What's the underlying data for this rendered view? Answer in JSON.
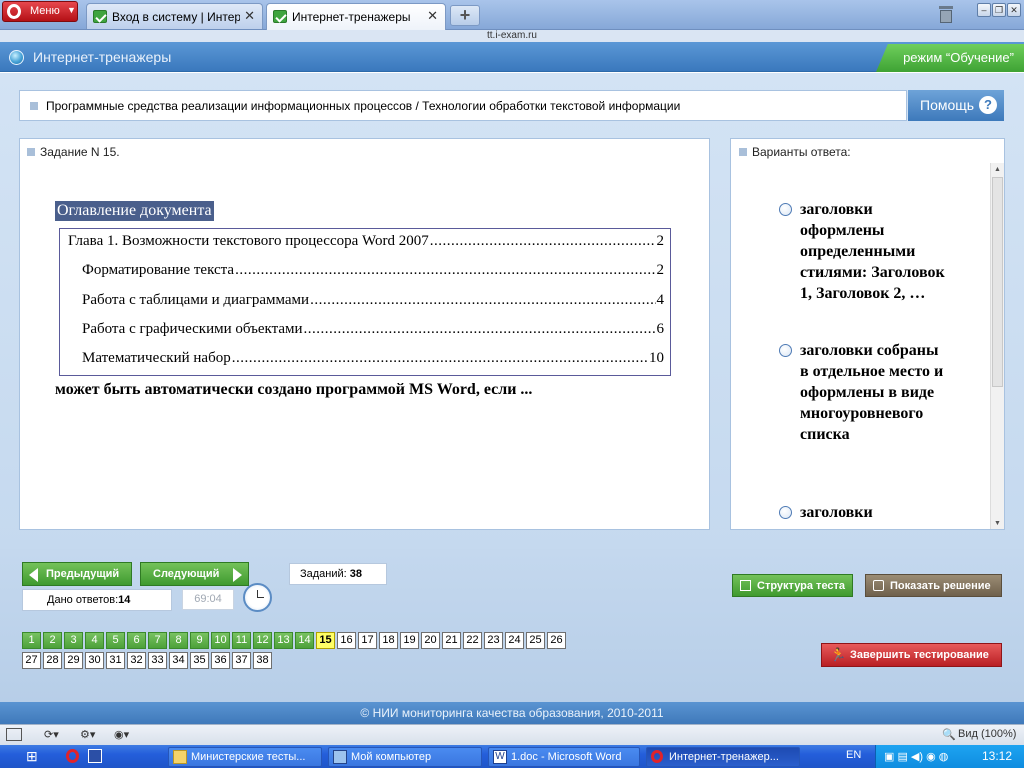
{
  "browser": {
    "menu_label": "Меню",
    "tabs": [
      {
        "title": "Вход в систему | Интер…",
        "active": false
      },
      {
        "title": "Интернет-тренажеры",
        "active": true
      }
    ],
    "new_tab_label": "+",
    "address": "tt.i-exam.ru",
    "zoom": "Вид (100%)"
  },
  "site": {
    "title": "Интернет-тренажеры",
    "mode": "режим “Обучение”",
    "breadcrumb": "Программные средства реализации информационных процессов / Технологии обработки текстовой информации",
    "help_label": "Помощь",
    "help_icon": "?"
  },
  "task": {
    "header": "Задание N 15.",
    "toc_heading": "Оглавление документа",
    "toc_entries": [
      {
        "text": "Глава 1. Возможности текстового процессора Word 2007",
        "page": "2"
      },
      {
        "text": "Форматирование текста",
        "page": "2"
      },
      {
        "text": "Работа с таблицами и диаграммами",
        "page": "4"
      },
      {
        "text": "Работа с графическими объектами",
        "page": "6"
      },
      {
        "text": "Математический набор",
        "page": "10"
      }
    ],
    "question": "может быть автоматически создано программой MS Word, если ..."
  },
  "answers": {
    "header": "Варианты ответа:",
    "options": [
      "заголовки оформлены определенными стилями: Заголовок 1, Заголовок 2, …",
      "заголовки собраны в отдельное место и оформлены в виде многоуровневого списка",
      "заголовки выделены полужирным"
    ]
  },
  "nav": {
    "prev_label": "Предыдущий",
    "next_label": "Следующий",
    "tasks_label": "Заданий:",
    "tasks_count": "38",
    "answered_label": "Дано ответов:",
    "answered_count": "14",
    "timer": "69:04",
    "structure_label": "Структура теста",
    "show_solution_label": "Показать решение",
    "finish_label": "Завершить тестирование",
    "questions": [
      "1",
      "2",
      "3",
      "4",
      "5",
      "6",
      "7",
      "8",
      "9",
      "10",
      "11",
      "12",
      "13",
      "14",
      "15",
      "16",
      "17",
      "18",
      "19",
      "20",
      "21",
      "22",
      "23",
      "24",
      "25",
      "26",
      "27",
      "28",
      "29",
      "30",
      "31",
      "32",
      "33",
      "34",
      "35",
      "36",
      "37",
      "38"
    ],
    "answered_through": 14,
    "current": 15
  },
  "footer": {
    "copyright": "© НИИ мониторинга качества образования, 2010-2011"
  },
  "taskbar": {
    "items": [
      {
        "label": "Министерские тесты...",
        "active": false
      },
      {
        "label": "Мой компьютер",
        "active": false
      },
      {
        "label": "1.doc - Microsoft Word",
        "active": false
      },
      {
        "label": "Интернет-тренажер...",
        "active": true
      }
    ],
    "lang": "EN",
    "time": "13:12"
  },
  "colors": {
    "brand_blue": "#3a78bd",
    "green": "#4da13a",
    "current_yellow": "#ffff66",
    "finish_red": "#b91f24"
  }
}
